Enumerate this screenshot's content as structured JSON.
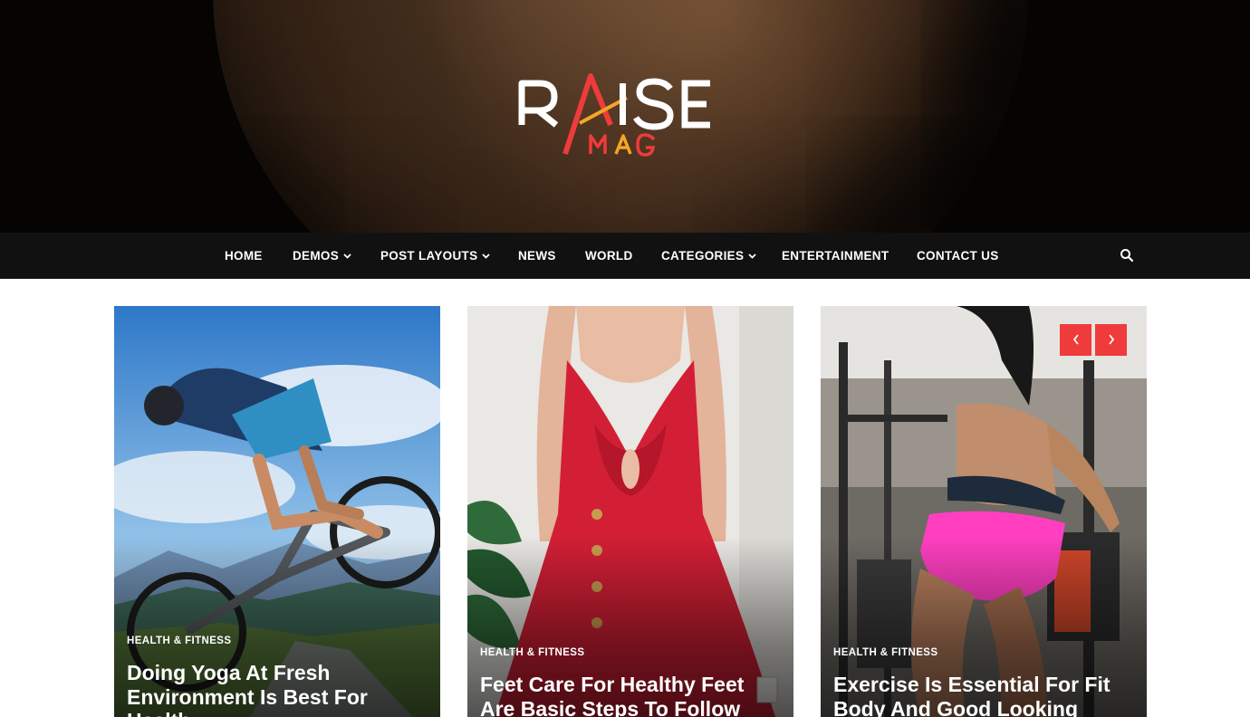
{
  "brand": {
    "logo_word": "RAISE",
    "logo_sub": "MAG",
    "colors": {
      "accent_red": "#ef3b3b",
      "accent_orange": "#f5a623",
      "nav_bg": "#111111"
    }
  },
  "nav": {
    "items": [
      {
        "label": "HOME",
        "has_dropdown": false
      },
      {
        "label": "DEMOS",
        "has_dropdown": true
      },
      {
        "label": "POST LAYOUTS",
        "has_dropdown": true
      },
      {
        "label": "NEWS",
        "has_dropdown": false
      },
      {
        "label": "WORLD",
        "has_dropdown": false
      },
      {
        "label": "CATEGORIES",
        "has_dropdown": true
      },
      {
        "label": "ENTERTAINMENT",
        "has_dropdown": false
      },
      {
        "label": "CONTACT US",
        "has_dropdown": false
      }
    ],
    "search_icon": "search-icon"
  },
  "slider": {
    "prev_icon": "chevron-left-icon",
    "next_icon": "chevron-right-icon",
    "cards": [
      {
        "category": "HEALTH & FITNESS",
        "title": "Doing Yoga At Fresh Environment Is Best For Health"
      },
      {
        "category": "HEALTH & FITNESS",
        "title": "Feet Care For Healthy Feet Are Basic Steps To Follow"
      },
      {
        "category": "HEALTH & FITNESS",
        "title": "Exercise Is Essential For Fit Body And Good Looking"
      }
    ]
  }
}
